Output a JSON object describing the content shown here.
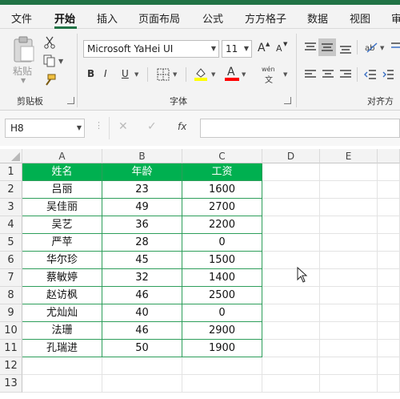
{
  "menu": {
    "tabs": [
      "文件",
      "开始",
      "插入",
      "页面布局",
      "公式",
      "方方格子",
      "数据",
      "视图",
      "审"
    ]
  },
  "ribbon": {
    "paste_label": "粘贴",
    "clipboard_group": "剪贴板",
    "font_name": "Microsoft YaHei UI",
    "font_size": "11",
    "bold": "B",
    "italic": "I",
    "underline": "U",
    "grow_font": "A",
    "shrink_font": "A",
    "phonetic_top": "wén",
    "phonetic_bottom": "文",
    "font_group": "字体",
    "alignment_group": "对齐方",
    "highlight_color": "#ffff00",
    "font_color": "#ff0000"
  },
  "formula_bar": {
    "name_box": "H8",
    "fx": "fx",
    "value": ""
  },
  "sheet": {
    "columns": [
      "A",
      "B",
      "C",
      "D",
      "E"
    ],
    "rows": [
      "1",
      "2",
      "3",
      "4",
      "5",
      "6",
      "7",
      "8",
      "9",
      "10",
      "11",
      "12",
      "13"
    ],
    "header": [
      "姓名",
      "年龄",
      "工资"
    ],
    "data": [
      [
        "吕丽",
        "23",
        "1600"
      ],
      [
        "吴佳丽",
        "49",
        "2700"
      ],
      [
        "吴艺",
        "36",
        "2200"
      ],
      [
        "严苹",
        "28",
        "0"
      ],
      [
        "华尔珍",
        "45",
        "1500"
      ],
      [
        "蔡敏婷",
        "32",
        "1400"
      ],
      [
        "赵访枫",
        "46",
        "2500"
      ],
      [
        "尤灿灿",
        "40",
        "0"
      ],
      [
        "法珊",
        "46",
        "2900"
      ],
      [
        "孔瑞进",
        "50",
        "1900"
      ]
    ],
    "header_color": "#00b050",
    "border_color": "#2e9e5b"
  }
}
